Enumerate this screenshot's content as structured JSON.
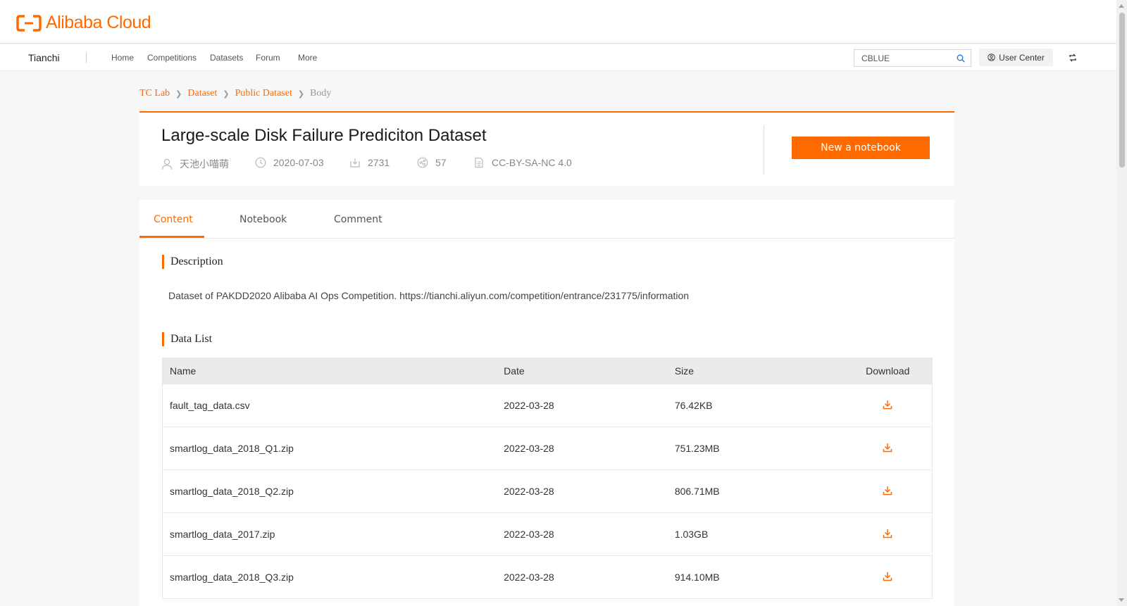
{
  "brand": {
    "logo_text": "Alibaba Cloud",
    "accent_color": "#ff6a00"
  },
  "nav": {
    "brand": "Tianchi",
    "links": [
      "Home",
      "Competitions",
      "Datasets",
      "Forum",
      "More"
    ],
    "search_value": "CBLUE",
    "user_center": "User Center"
  },
  "breadcrumb": [
    "TC Lab",
    "Dataset",
    "Public Dataset",
    "Body"
  ],
  "dataset": {
    "title": "Large-scale Disk Failure Prediciton Dataset",
    "author": "天池小喵萌",
    "date": "2020-07-03",
    "downloads": "2731",
    "shares": "57",
    "license": "CC-BY-SA-NC 4.0",
    "notebook_button": "New a notebook"
  },
  "tabs": [
    "Content",
    "Notebook",
    "Comment"
  ],
  "active_tab": "Content",
  "description": {
    "heading": "Description",
    "text": "Dataset of PAKDD2020 Alibaba AI Ops Competition. https://tianchi.aliyun.com/competition/entrance/231775/information"
  },
  "data_list": {
    "heading": "Data List",
    "columns": [
      "Name",
      "Date",
      "Size",
      "Download"
    ],
    "rows": [
      {
        "name": "fault_tag_data.csv",
        "date": "2022-03-28",
        "size": "76.42KB"
      },
      {
        "name": "smartlog_data_2018_Q1.zip",
        "date": "2022-03-28",
        "size": "751.23MB"
      },
      {
        "name": "smartlog_data_2018_Q2.zip",
        "date": "2022-03-28",
        "size": "806.71MB"
      },
      {
        "name": "smartlog_data_2017.zip",
        "date": "2022-03-28",
        "size": "1.03GB"
      },
      {
        "name": "smartlog_data_2018_Q3.zip",
        "date": "2022-03-28",
        "size": "914.10MB"
      }
    ]
  }
}
